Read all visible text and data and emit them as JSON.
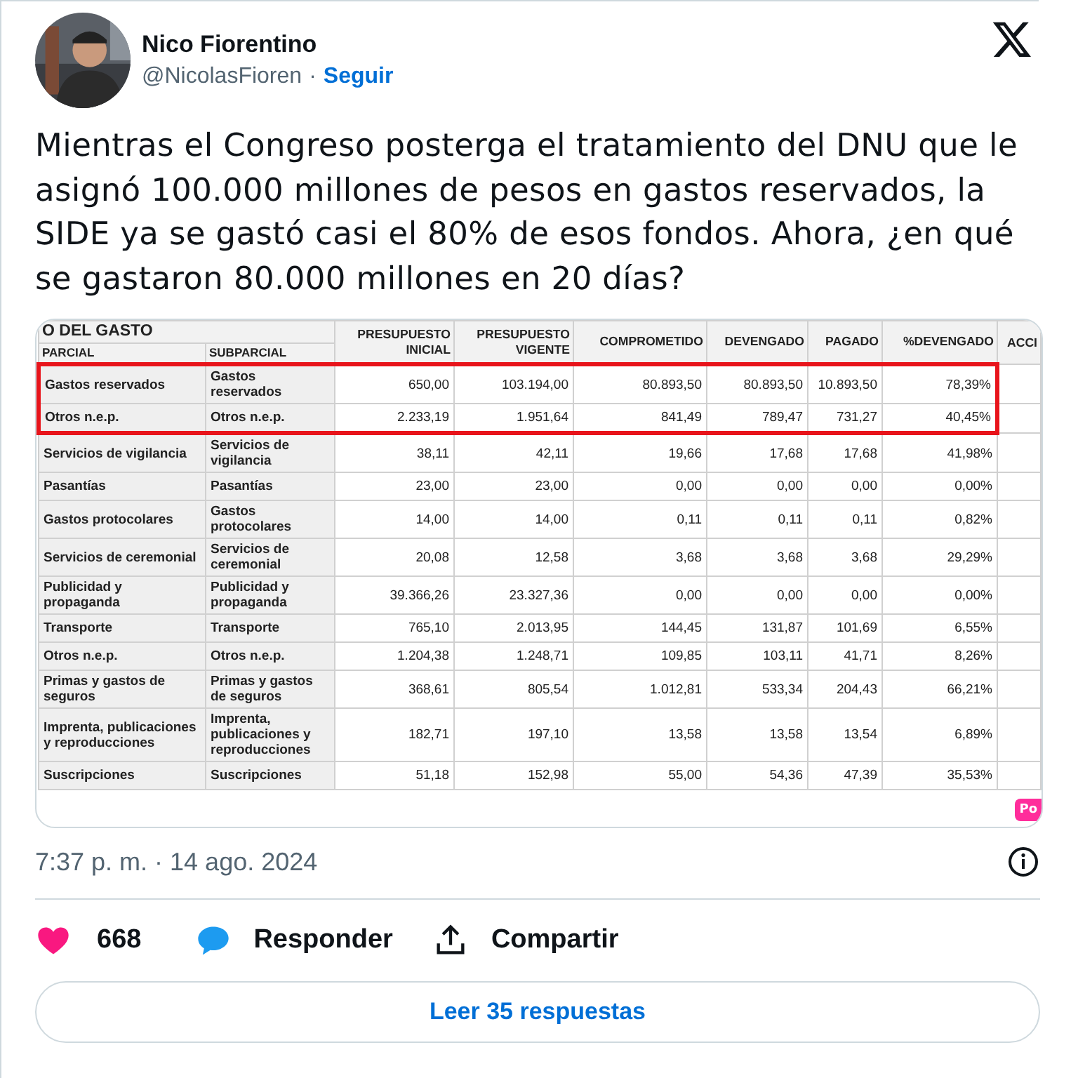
{
  "author": {
    "name": "Nico Fiorentino",
    "handle": "@NicolasFioren",
    "separator": "·",
    "follow": "Seguir"
  },
  "text": "Mientras el Congreso posterga el tratamiento del DNU que le asignó 100.000 millones de pesos en gastos reservados, la SIDE ya se gastó casi el 80% de esos fondos. Ahora, ¿en qué se gastaron 80.000 millones en 20 días?",
  "table": {
    "group_header": "O DEL GASTO",
    "columns": [
      "PARCIAL",
      "SUBPARCIAL",
      "PRESUPUESTO INICIAL",
      "PRESUPUESTO VIGENTE",
      "COMPROMETIDO",
      "DEVENGADO",
      "PAGADO",
      "%DEVENGADO",
      "ACCI"
    ],
    "rows": [
      {
        "highlighted": true,
        "cells": [
          "Gastos reservados",
          "Gastos reservados",
          "650,00",
          "103.194,00",
          "80.893,50",
          "80.893,50",
          "10.893,50",
          "78,39%"
        ]
      },
      {
        "highlighted": true,
        "cells": [
          "Otros n.e.p.",
          "Otros n.e.p.",
          "2.233,19",
          "1.951,64",
          "841,49",
          "789,47",
          "731,27",
          "40,45%"
        ]
      },
      {
        "highlighted": false,
        "cells": [
          "Servicios de vigilancia",
          "Servicios de vigilancia",
          "38,11",
          "42,11",
          "19,66",
          "17,68",
          "17,68",
          "41,98%"
        ]
      },
      {
        "highlighted": false,
        "cells": [
          "Pasantías",
          "Pasantías",
          "23,00",
          "23,00",
          "0,00",
          "0,00",
          "0,00",
          "0,00%"
        ]
      },
      {
        "highlighted": false,
        "cells": [
          "Gastos protocolares",
          "Gastos protocolares",
          "14,00",
          "14,00",
          "0,11",
          "0,11",
          "0,11",
          "0,82%"
        ]
      },
      {
        "highlighted": false,
        "cells": [
          "Servicios de ceremonial",
          "Servicios de ceremonial",
          "20,08",
          "12,58",
          "3,68",
          "3,68",
          "3,68",
          "29,29%"
        ]
      },
      {
        "highlighted": false,
        "cells": [
          "Publicidad y propaganda",
          "Publicidad y propaganda",
          "39.366,26",
          "23.327,36",
          "0,00",
          "0,00",
          "0,00",
          "0,00%"
        ]
      },
      {
        "highlighted": false,
        "cells": [
          "Transporte",
          "Transporte",
          "765,10",
          "2.013,95",
          "144,45",
          "131,87",
          "101,69",
          "6,55%"
        ]
      },
      {
        "highlighted": false,
        "cells": [
          "Otros n.e.p.",
          "Otros n.e.p.",
          "1.204,38",
          "1.248,71",
          "109,85",
          "103,11",
          "41,71",
          "8,26%"
        ]
      },
      {
        "highlighted": false,
        "cells": [
          "Primas y gastos de seguros",
          "Primas y gastos de seguros",
          "368,61",
          "805,54",
          "1.012,81",
          "533,34",
          "204,43",
          "66,21%"
        ]
      },
      {
        "highlighted": false,
        "cells": [
          "Imprenta, publicaciones y reproducciones",
          "Imprenta, publicaciones y reproducciones",
          "182,71",
          "197,10",
          "13,58",
          "13,58",
          "13,54",
          "6,89%"
        ]
      },
      {
        "highlighted": false,
        "cells": [
          "Suscripciones",
          "Suscripciones",
          "51,18",
          "152,98",
          "55,00",
          "54,36",
          "47,39",
          "35,53%"
        ]
      }
    ],
    "badge": "Po"
  },
  "timestamp": "7:37 p. m. · 14 ago. 2024",
  "actions": {
    "likes": "668",
    "liked": true,
    "reply": "Responder",
    "share": "Compartir"
  },
  "read_replies": "Leer 35 respuestas"
}
